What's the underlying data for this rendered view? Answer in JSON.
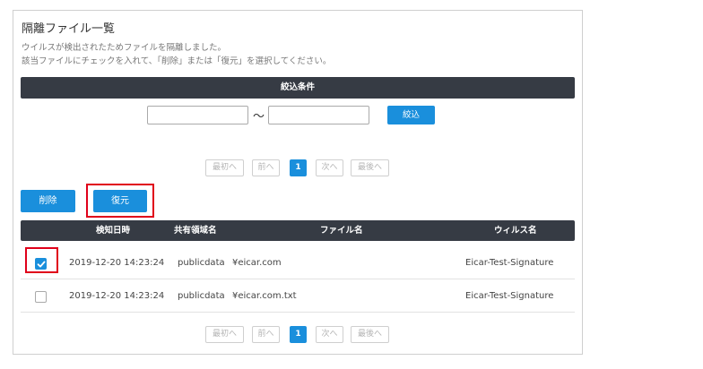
{
  "page": {
    "title": "隔離ファイル一覧",
    "description_line1": "ウイルスが検出されたためファイルを隔離しました。",
    "description_line2": "該当ファイルにチェックを入れて、「削除」または「復元」を選択してください。"
  },
  "filter": {
    "header": "絞込条件",
    "from_value": "",
    "to_value": "",
    "separator": "～",
    "button_label": "絞込"
  },
  "pagination": {
    "first": "最初へ",
    "prev": "前へ",
    "current": "1",
    "next": "次へ",
    "last": "最後へ"
  },
  "actions": {
    "delete_label": "削除",
    "restore_label": "復元"
  },
  "table": {
    "columns": [
      "",
      "検知日時",
      "共有領域名",
      "ファイル名",
      "ウィルス名"
    ],
    "rows": [
      {
        "checked": true,
        "detected_at": "2019-12-20 14:23:24",
        "share": "publicdata",
        "file": "¥eicar.com",
        "virus": "Eicar-Test-Signature"
      },
      {
        "checked": false,
        "detected_at": "2019-12-20 14:23:24",
        "share": "publicdata",
        "file": "¥eicar.com.txt",
        "virus": "Eicar-Test-Signature"
      }
    ]
  },
  "colors": {
    "accent": "#1a8fdc",
    "header_bg": "#363b44",
    "highlight": "#e0001a"
  }
}
